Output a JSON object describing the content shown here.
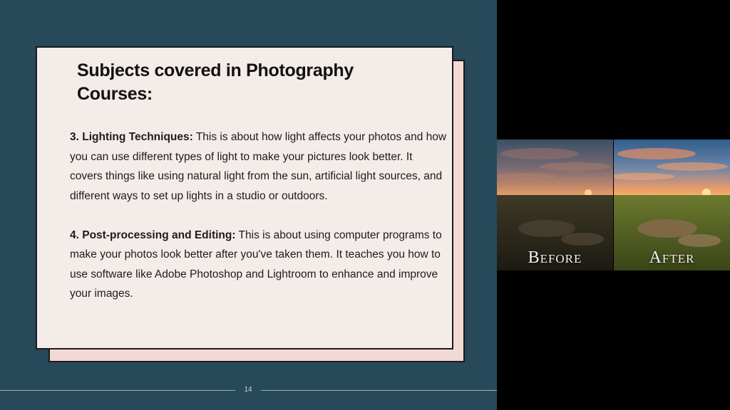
{
  "slide": {
    "title": "Subjects covered in Photography Courses:",
    "sections": [
      {
        "heading": "3. Lighting Techniques:",
        "text": " This is about how light affects your photos and how you can use different types of light to make your pictures look better. It covers things like using natural light from the sun, artificial light sources, and different ways to set up lights in a studio or outdoors."
      },
      {
        "heading": "4. Post-processing and Editing:",
        "text": " This is about using computer programs to make your photos look better after you've taken them. It teaches you how to use software like Adobe Photoshop and Lightroom to enhance and improve your images."
      }
    ],
    "page_number": "14"
  },
  "image": {
    "before_label": "Before",
    "after_label": "After"
  },
  "colors": {
    "background": "#27495a",
    "card": "#f4ece9",
    "card_shadow": "#f3d9d3"
  }
}
